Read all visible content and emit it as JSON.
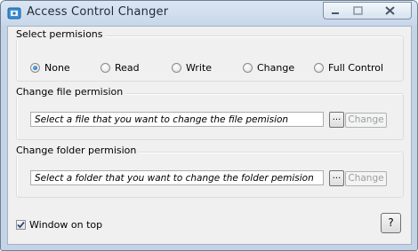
{
  "window": {
    "title": "Access Control Changer",
    "icon": "lock-app-icon"
  },
  "permissions": {
    "label": "Select permisions",
    "selected": "None",
    "options": [
      "None",
      "Read",
      "Write",
      "Change",
      "Full Control"
    ]
  },
  "file": {
    "label": "Change file permision",
    "placeholder": "Select a file that you want to change the file pemision",
    "browse_label": "...",
    "change_label": "Change"
  },
  "folder": {
    "label": "Change folder permision",
    "placeholder": "Select a folder that you want to change the folder pemision",
    "browse_label": "...",
    "change_label": "Change"
  },
  "footer": {
    "window_on_top_label": "Window on top",
    "window_on_top_checked": true,
    "help_label": "?"
  }
}
